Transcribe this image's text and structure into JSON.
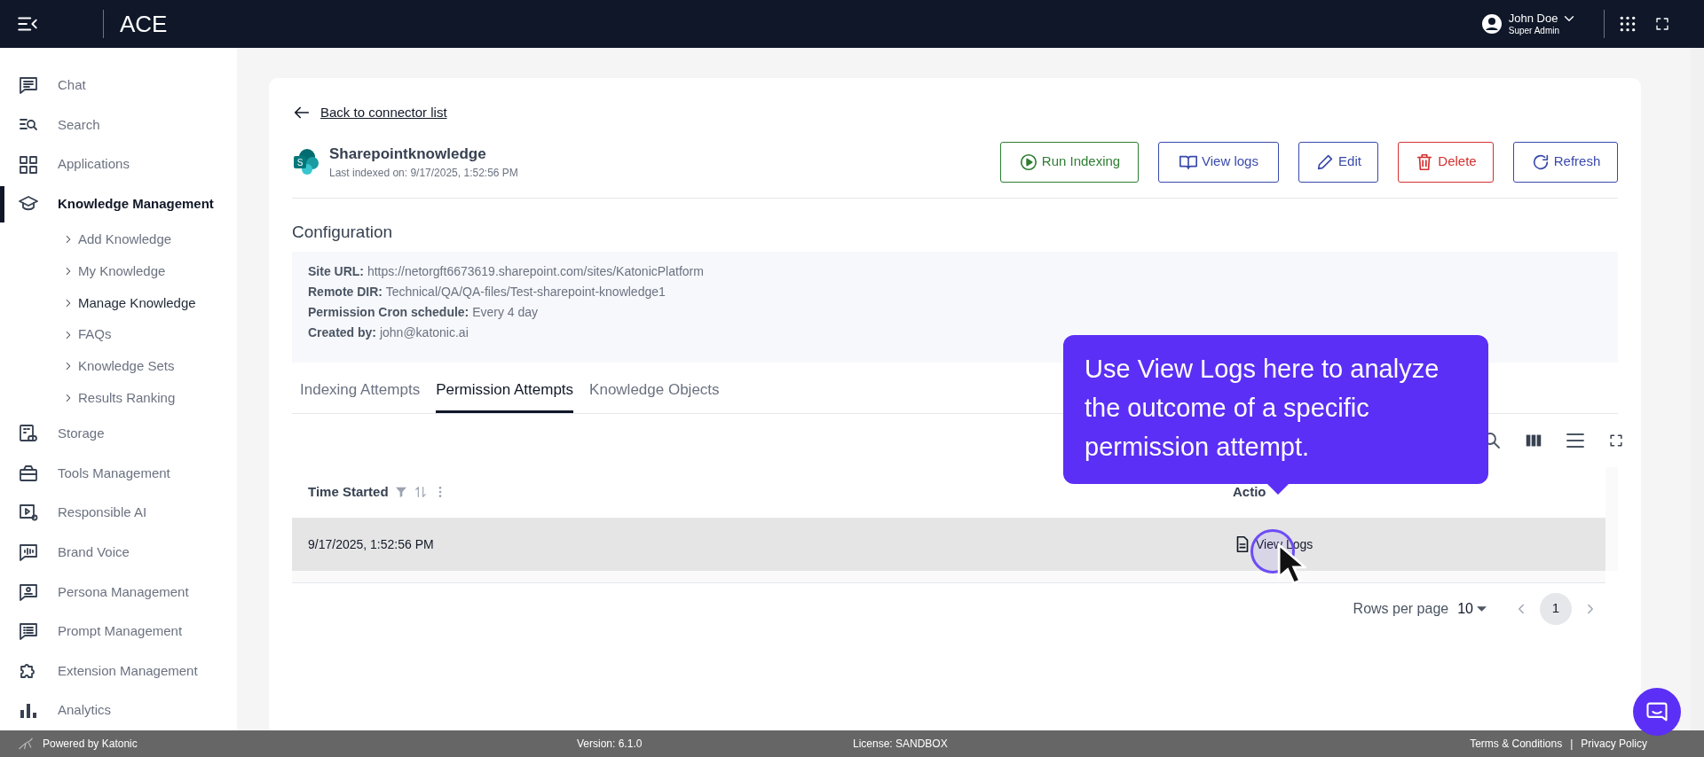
{
  "app": {
    "title": "ACE"
  },
  "user": {
    "name": "John Doe",
    "role": "Super Admin"
  },
  "sidebar": {
    "items": [
      {
        "label": "Chat",
        "selected": false
      },
      {
        "label": "Search",
        "selected": false
      },
      {
        "label": "Applications",
        "selected": false
      },
      {
        "label": "Knowledge Management",
        "selected": true,
        "children": [
          {
            "label": "Add Knowledge",
            "selected": false
          },
          {
            "label": "My Knowledge",
            "selected": false
          },
          {
            "label": "Manage Knowledge",
            "selected": true
          },
          {
            "label": "FAQs",
            "selected": false
          },
          {
            "label": "Knowledge Sets",
            "selected": false
          },
          {
            "label": "Results Ranking",
            "selected": false
          }
        ]
      },
      {
        "label": "Storage",
        "selected": false
      },
      {
        "label": "Tools Management",
        "selected": false
      },
      {
        "label": "Responsible AI",
        "selected": false
      },
      {
        "label": "Brand Voice",
        "selected": false
      },
      {
        "label": "Persona Management",
        "selected": false
      },
      {
        "label": "Prompt Management",
        "selected": false
      },
      {
        "label": "Extension Management",
        "selected": false
      },
      {
        "label": "Analytics",
        "selected": false
      }
    ]
  },
  "back_link": "Back to connector list",
  "connector": {
    "logo_letter": "S",
    "name": "Sharepointknowledge",
    "last_indexed": "Last indexed on: 9/17/2025, 1:52:56 PM"
  },
  "actions": [
    {
      "label": "Run Indexing",
      "kind": "run"
    },
    {
      "label": "View logs",
      "kind": "logs"
    },
    {
      "label": "Edit",
      "kind": "edit"
    },
    {
      "label": "Delete",
      "kind": "delete"
    },
    {
      "label": "Refresh",
      "kind": "refresh"
    }
  ],
  "configuration": {
    "title": "Configuration",
    "fields": [
      {
        "label": "Site URL:",
        "value": "https://netorgft6673619.sharepoint.com/sites/KatonicPlatform"
      },
      {
        "label": "Remote DIR:",
        "value": "Technical/QA/QA-files/Test-sharepoint-knowledge1"
      },
      {
        "label": "Permission Cron schedule:",
        "value": "Every 4 day"
      },
      {
        "label": "Created by:",
        "value": "john@katonic.ai"
      }
    ]
  },
  "tabs": [
    {
      "label": "Indexing Attempts",
      "selected": false
    },
    {
      "label": "Permission Attempts",
      "selected": true
    },
    {
      "label": "Knowledge Objects",
      "selected": false
    }
  ],
  "table": {
    "columns": [
      "Time Started",
      "Actio"
    ],
    "rows": [
      {
        "time": "9/17/2025, 1:52:56 PM",
        "action": "View Logs"
      }
    ]
  },
  "pagination": {
    "rows_per_page_label": "Rows per page",
    "rows_per_page": "10",
    "page": "1"
  },
  "tooltip": "Use View Logs here to analyze the outcome of a specific permission attempt.",
  "footer": {
    "powered_by": "Powered by Katonic",
    "version": "Version: 6.1.0",
    "license": "License: SANDBOX",
    "links": [
      "Terms & Conditions",
      "Privacy Policy"
    ],
    "separator": "|"
  }
}
